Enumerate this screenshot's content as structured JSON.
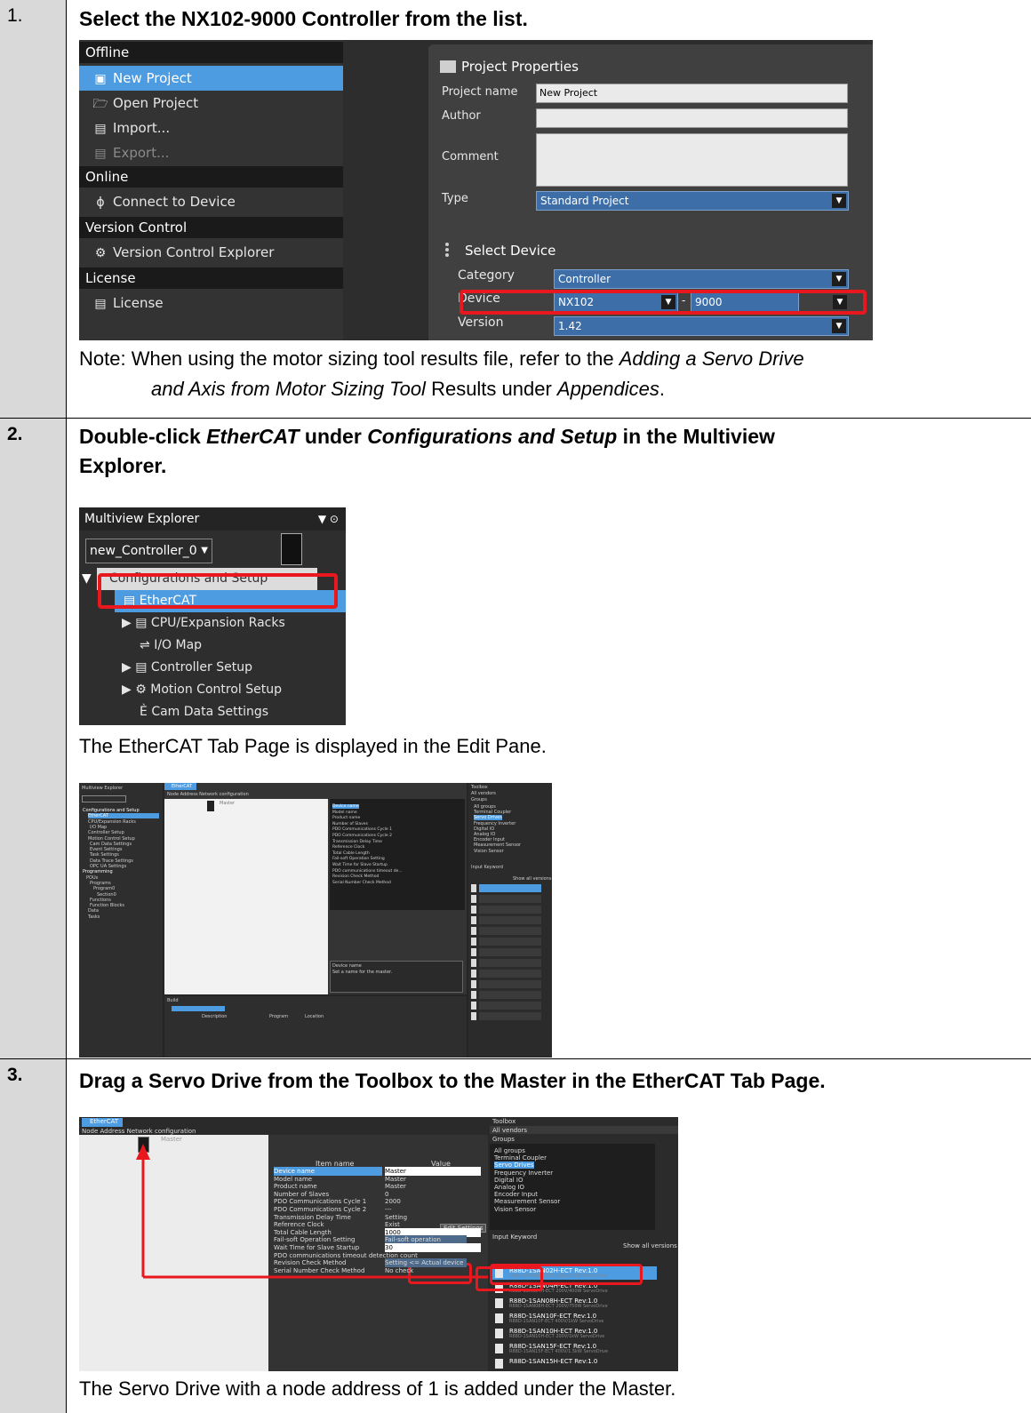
{
  "steps": [
    {
      "number": "1.",
      "title": "Select the NX102-9000 Controller from the list.",
      "note_prefix": "Note: When using the motor sizing tool results file, refer to the ",
      "note_ref": "Adding a Servo Drive",
      "note_ref2": "and Axis from Motor Sizing Tool",
      "note_mid": " Results under ",
      "note_appendix": "Appendices",
      "note_end": "."
    },
    {
      "number": "2.",
      "title_pre": "Double-click ",
      "title_em1": "EtherCAT",
      "title_mid": " under ",
      "title_em2": "Configurations and Setup",
      "title_post": " in the Multiview",
      "title_line2": "Explorer.",
      "result": "The EtherCAT Tab Page is displayed in the Edit Pane."
    },
    {
      "number": "3.",
      "title": "Drag a Servo Drive from the Toolbox to the Master in the EtherCAT Tab Page.",
      "result": "The Servo Drive with a node address of 1 is added under the Master."
    }
  ],
  "screenshot1": {
    "offline_header": "Offline",
    "offline_items": [
      {
        "label": "New Project",
        "icon": "new-project-icon",
        "selected": true
      },
      {
        "label": "Open Project",
        "icon": "folder-icon"
      },
      {
        "label": "Import...",
        "icon": "import-icon"
      },
      {
        "label": "Export...",
        "icon": "export-icon",
        "disabled": true
      }
    ],
    "online_header": "Online",
    "online_items": [
      {
        "label": "Connect to Device",
        "icon": "connect-icon"
      }
    ],
    "version_header": "Version Control",
    "version_items": [
      {
        "label": "Version Control Explorer",
        "icon": "version-control-icon"
      }
    ],
    "license_header": "License",
    "license_items": [
      {
        "label": "License",
        "icon": "license-icon"
      }
    ],
    "project_properties_title": "Project Properties",
    "project_name_label": "Project name",
    "project_name_value": "New Project",
    "author_label": "Author",
    "author_value": "",
    "comment_label": "Comment",
    "comment_value": "",
    "type_label": "Type",
    "type_value": "Standard Project",
    "select_device_title": "Select Device",
    "category_label": "Category",
    "category_value": "Controller",
    "device_label": "Device",
    "device_value": "NX102",
    "device_separator": "-",
    "device_model": "9000",
    "version_label": "Version",
    "version_value": "1.42"
  },
  "screenshot2": {
    "title": "Multiview Explorer",
    "controller": "new_Controller_0",
    "tree": [
      {
        "label": "Configurations and Setup",
        "icon": "expanded-arrow-icon",
        "group": true
      },
      {
        "label": "EtherCAT",
        "icon": "ethercat-icon",
        "selected": true
      },
      {
        "label": "CPU/Expansion Racks",
        "icon": "rack-icon",
        "expandable": true
      },
      {
        "label": "I/O Map",
        "icon": "io-map-icon"
      },
      {
        "label": "Controller Setup",
        "icon": "controller-setup-icon",
        "expandable": true
      },
      {
        "label": "Motion Control Setup",
        "icon": "gear-icon",
        "expandable": true
      },
      {
        "label": "Cam Data Settings",
        "icon": "cam-icon"
      }
    ]
  },
  "screenshot3": {
    "explorer_title": "Multiview Explorer",
    "tab": "EtherCAT",
    "node_header": "Node Address Network configuration",
    "master_label": "Master",
    "toolbox_title": "Toolbox",
    "vendor": "All vendors",
    "groups_label": "Groups",
    "build_title": "Build",
    "tree": [
      "Configurations and Setup",
      "EtherCAT",
      "CPU/Expansion Racks",
      "I/O Map",
      "Controller Setup",
      "Motion Control Setup",
      "Cam Data Settings",
      "Event Settings",
      "Task Settings",
      "Data Trace Settings",
      "OPC UA Settings",
      "Programming",
      "POUs",
      "Programs",
      "Program0",
      "Section0",
      "Functions",
      "Function Blocks",
      "Data",
      "Tasks"
    ],
    "properties": [
      "Device name",
      "Model name",
      "Product name",
      "Number of Slaves",
      "PDO Communications Cycle 1",
      "PDO Communications Cycle 2",
      "Transmission Delay Time",
      "Reference Clock",
      "Total Cable Length",
      "Fail-soft Operation Setting",
      "Wait Time for Slave Startup",
      "PDO communications timeout de...",
      "Revision Check Method",
      "Serial Number Check Method"
    ],
    "groups": [
      "All groups",
      "Terminal Coupler",
      "Servo Drives",
      "Frequency Inverter",
      "Digital IO",
      "Analog IO",
      "Encoder Input",
      "Measurement Sensor",
      "Vision Sensor"
    ],
    "input_keyword": "Input Keyword",
    "show_all": "Show all versions",
    "device_desc_title": "Device name",
    "device_desc_text": "Set a name for the master.",
    "build_columns": [
      "Description",
      "Program",
      "Location"
    ]
  },
  "screenshot4": {
    "tab": "EtherCAT",
    "node_header": "Node Address Network configuration",
    "master_label": "Master",
    "item_name_header": "Item name",
    "value_header": "Value",
    "properties": [
      {
        "name": "Device name",
        "value": "Master",
        "selected": true
      },
      {
        "name": "Model name",
        "value": "Master"
      },
      {
        "name": "Product name",
        "value": "Master"
      },
      {
        "name": "Number of Slaves",
        "value": "0"
      },
      {
        "name": "PDO Communications Cycle 1",
        "value": "2000"
      },
      {
        "name": "PDO Communications Cycle 2",
        "value": "---"
      },
      {
        "name": "Transmission Delay Time",
        "value": "Setting"
      },
      {
        "name": "Reference Clock",
        "value": "Exist"
      },
      {
        "name": "Total Cable Length",
        "value": "1000"
      },
      {
        "name": "Fail-soft Operation Setting",
        "value": "Fail-soft operation"
      },
      {
        "name": "Wait Time for Slave Startup",
        "value": "30"
      },
      {
        "name": "PDO communications timeout detection count",
        "value": ""
      },
      {
        "name": "Revision Check Method",
        "value": "Setting <= Actual device"
      },
      {
        "name": "Serial Number Check Method",
        "value": "No check"
      }
    ],
    "edit_settings": "Edit Settings",
    "toolbox_title": "Toolbox",
    "vendor": "All vendors",
    "groups_label": "Groups",
    "groups": [
      "All groups",
      "Terminal Coupler",
      "Servo Drives",
      "Frequency Inverter",
      "Digital IO",
      "Analog IO",
      "Encoder Input",
      "Measurement Sensor",
      "Vision Sensor"
    ],
    "input_keyword": "Input Keyword",
    "show_all": "Show all versions",
    "drives": [
      {
        "name": "R88D-1SAN02H-ECT Rev:1.0",
        "sub": "R88D-1SAN02H-ECT 200V/200W ServoDrive"
      },
      {
        "name": "R88D-1SAN04H-ECT Rev:1.0",
        "sub": "R88D-1SAN04H-ECT 200V/400W ServoDrive"
      },
      {
        "name": "R88D-1SAN08H-ECT Rev:1.0",
        "sub": "R88D-1SAN08H-ECT 200V/750W ServoDrive"
      },
      {
        "name": "R88D-1SAN10F-ECT Rev:1.0",
        "sub": "R88D-1SAN10F-ECT 400V/1kW ServoDrive"
      },
      {
        "name": "R88D-1SAN10H-ECT Rev:1.0",
        "sub": "R88D-1SAN10H-ECT 200V/1kW ServoDrive"
      },
      {
        "name": "R88D-1SAN15F-ECT Rev:1.0",
        "sub": "R88D-1SAN15F-ECT 400V/1.5kW ServoDrive"
      },
      {
        "name": "R88D-1SAN15H-ECT Rev:1.0",
        "sub": ""
      }
    ]
  },
  "colors": {
    "highlight": "#e8181e",
    "selection": "#4d9be0",
    "number_cell": "#d9d9d9"
  }
}
